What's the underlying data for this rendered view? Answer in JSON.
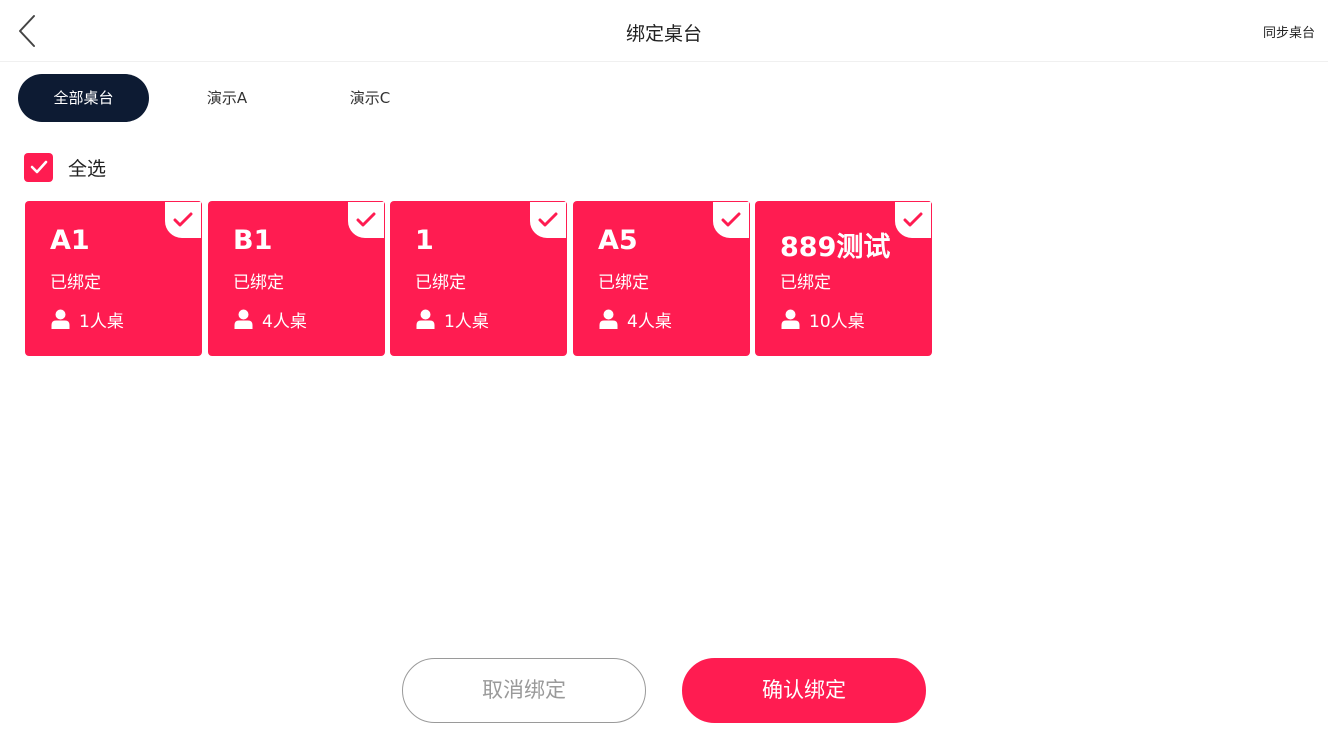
{
  "header": {
    "title": "绑定桌台",
    "sync_label": "同步桌台",
    "back_icon": "chevron-left-icon"
  },
  "tabs": [
    {
      "label": "全部桌台",
      "active": true
    },
    {
      "label": "演示A",
      "active": false
    },
    {
      "label": "演示C",
      "active": false
    }
  ],
  "select_all": {
    "label": "全选",
    "checked": true
  },
  "tables": [
    {
      "name": "A1",
      "status": "已绑定",
      "capacity": "1人桌",
      "selected": true
    },
    {
      "name": "B1",
      "status": "已绑定",
      "capacity": "4人桌",
      "selected": true
    },
    {
      "name": "1",
      "status": "已绑定",
      "capacity": "1人桌",
      "selected": true
    },
    {
      "name": "A5",
      "status": "已绑定",
      "capacity": "4人桌",
      "selected": true
    },
    {
      "name": "889测试",
      "status": "已绑定",
      "capacity": "10人桌",
      "selected": true
    }
  ],
  "actions": {
    "cancel_label": "取消绑定",
    "confirm_label": "确认绑定"
  },
  "colors": {
    "accent": "#ff1c51",
    "tab_active_bg": "#0d1b33"
  }
}
